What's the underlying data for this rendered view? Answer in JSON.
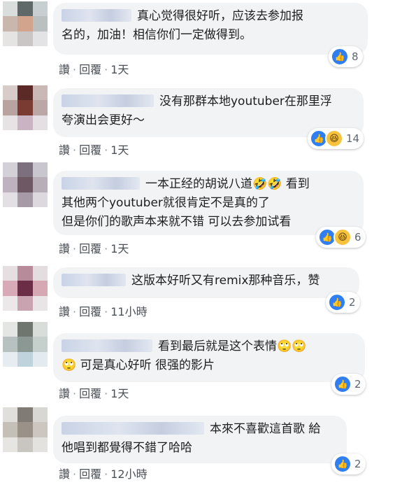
{
  "actions": {
    "like_label": "讚",
    "separator": "·",
    "reply_label": "回覆"
  },
  "comments": [
    {
      "text": "真心觉得很好听，应该去参加报\n名的，加油！相信你们一定做得到。",
      "time": "1天",
      "reaction_count": "8",
      "reactions": [
        "like-icon"
      ]
    },
    {
      "text": "没有那群本地youtuber在那里浮\n夸演出会更好～",
      "time": "1天",
      "reaction_count": "14",
      "reactions": [
        "like-icon",
        "haha-icon"
      ]
    },
    {
      "text": "一本正经的胡说八道🤣🤣 看到\n其他两个youtuber就很肯定不是真的了\n但是你们的歌声本来就不错 可以去参加试看",
      "time": "1天",
      "reaction_count": "6",
      "reactions": [
        "like-icon",
        "haha-icon"
      ]
    },
    {
      "text": "这版本好听又有remix那种音乐，赞",
      "time": "11小時",
      "reaction_count": "2",
      "reactions": [
        "like-icon"
      ]
    },
    {
      "text": "看到最后就是这个表情🙄🙄\n🙄 可是真心好听 很强的影片",
      "time": "1天",
      "reaction_count": "2",
      "reactions": [
        "like-icon"
      ]
    },
    {
      "text": "本來不喜歡這首歌 給\n他唱到都覺得不錯了哈哈",
      "time": "12小時",
      "reaction_count": "2",
      "reactions": [
        "like-icon"
      ]
    }
  ],
  "colors": {
    "bubble": "#f2f3f5",
    "like": "#2f7ff2",
    "haha": "#f7c23c",
    "meta": "#4b4f56"
  }
}
